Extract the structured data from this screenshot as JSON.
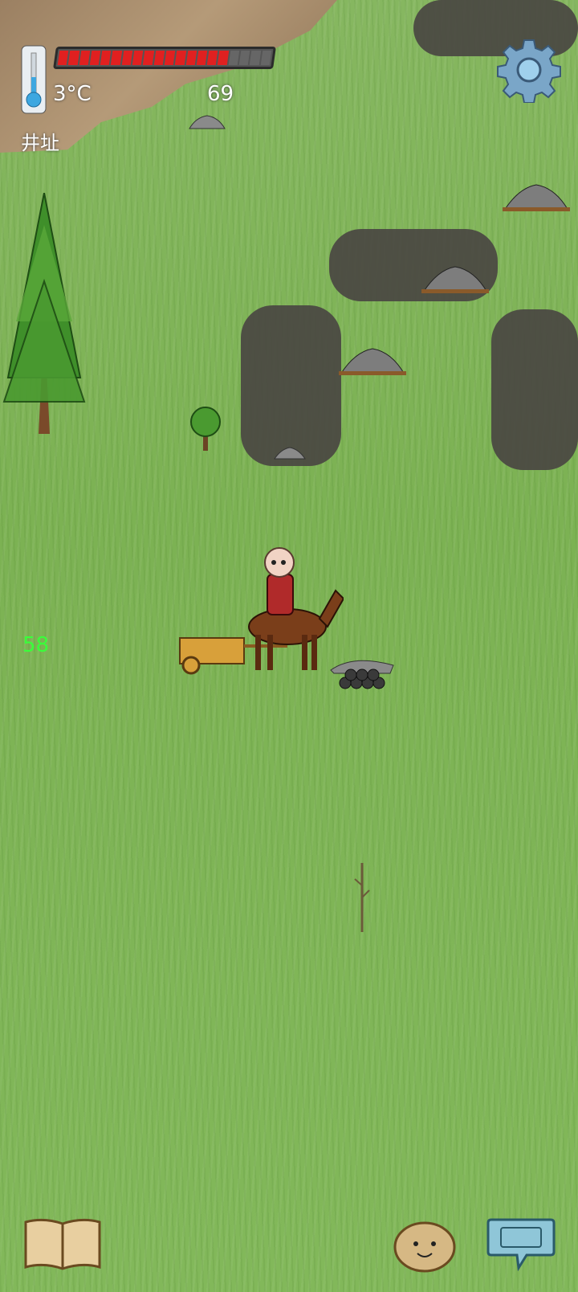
{
  "hud": {
    "temperature": "3°C",
    "food_level": 69,
    "location_label": "井址",
    "health_fraction": 0.8,
    "age_indicator": "58"
  },
  "colors": {
    "health_fill": "#e02020",
    "age_text": "#39ff3a",
    "grass": "#7fb25a"
  },
  "icons": {
    "thermometer": "thermometer-icon",
    "settings": "gear-icon",
    "recipe_book": "book-icon",
    "emote": "face-icon",
    "chat": "keyboard-icon"
  }
}
